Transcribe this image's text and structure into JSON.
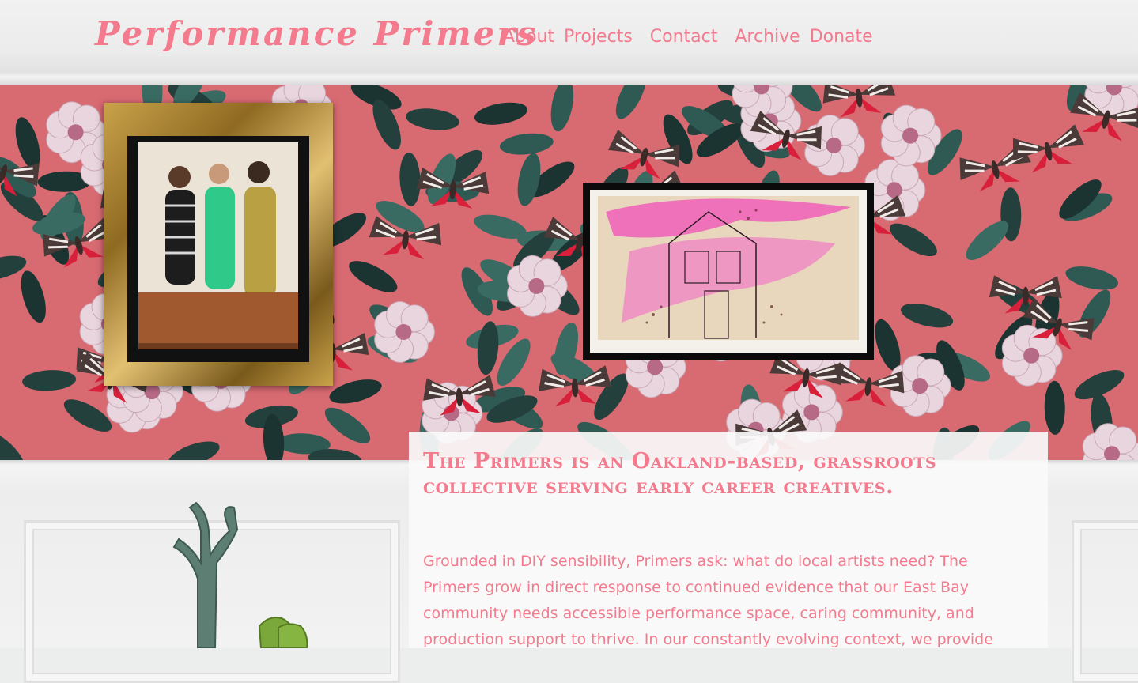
{
  "site": {
    "logo": "Performance Primers"
  },
  "nav": [
    {
      "label": "About"
    },
    {
      "label": "Projects"
    },
    {
      "label": "Contact"
    },
    {
      "label": "Archive"
    },
    {
      "label": "Donate"
    }
  ],
  "colors": {
    "accent": "#f47b8d",
    "wallpaper_base": "#2c3f3f"
  },
  "intro": {
    "heading": "The Primers is an Oakland-based, grassroots collective serving early career creatives.",
    "body": "Grounded in DIY sensibility, Primers ask: what do local artists need? The Primers grow in direct response to continued evidence that our East Bay community needs accessible performance space, caring community, and production support to thrive. In our constantly evolving context, we provide"
  }
}
